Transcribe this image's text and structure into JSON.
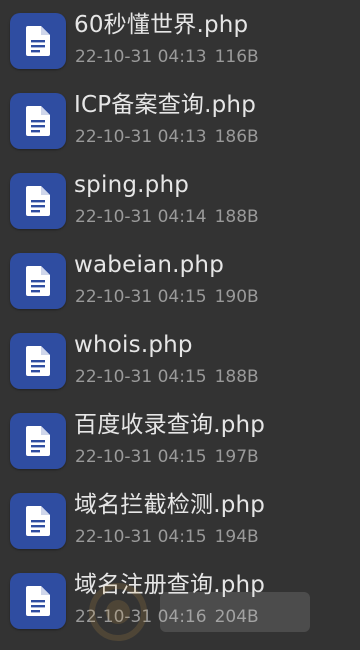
{
  "icon_color": "#2f4da1",
  "file_icon_name": "document-file-icon",
  "files": [
    {
      "name": "60秒懂世界.php",
      "date": "22-10-31 04:13",
      "size": "116B"
    },
    {
      "name": "ICP备案查询.php",
      "date": "22-10-31 04:13",
      "size": "186B"
    },
    {
      "name": "sping.php",
      "date": "22-10-31 04:14",
      "size": "188B"
    },
    {
      "name": "wabeian.php",
      "date": "22-10-31 04:15",
      "size": "190B"
    },
    {
      "name": "whois.php",
      "date": "22-10-31 04:15",
      "size": "188B"
    },
    {
      "name": "百度收录查询.php",
      "date": "22-10-31 04:15",
      "size": "197B"
    },
    {
      "name": "域名拦截检测.php",
      "date": "22-10-31 04:15",
      "size": "194B"
    },
    {
      "name": "域名注册查询.php",
      "date": "22-10-31 04:16",
      "size": "204B"
    }
  ]
}
